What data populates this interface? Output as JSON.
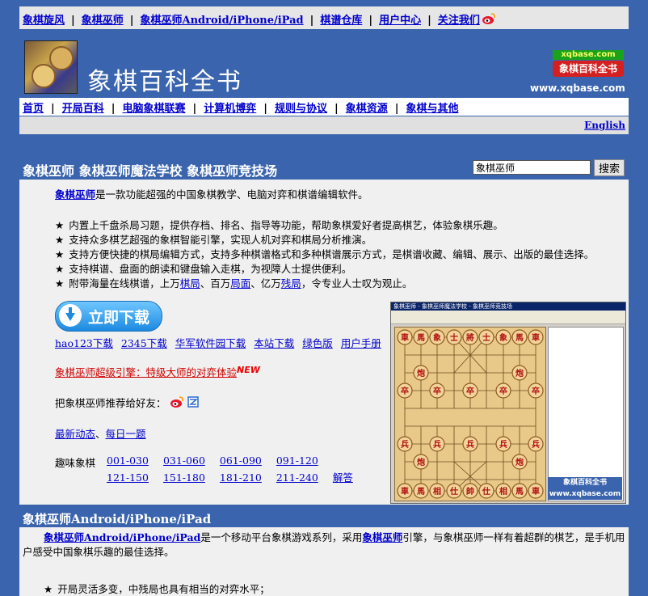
{
  "top_nav": {
    "items": [
      "象棋旋风",
      "象棋巫师",
      "象棋巫师Android/iPhone/iPad",
      "棋谱仓库",
      "用户中心",
      "关注我们"
    ],
    "separator": "|"
  },
  "banner": {
    "title": "象棋百科全书",
    "badge_top": "xqbase.com",
    "badge_bottom": "象棋百科全书",
    "url": "www.xqbase.com"
  },
  "main_nav": {
    "items": [
      "首页",
      "开局百科",
      "电脑象棋联赛",
      "计算机博弈",
      "规则与协议",
      "象棋资源",
      "象棋与其他"
    ],
    "separator": "|"
  },
  "language_link": "English",
  "section1": {
    "title": "象棋巫师  象棋巫师魔法学校  象棋巫师竞技场",
    "search": {
      "value": "象棋巫师",
      "button": "搜索"
    },
    "intro_link": "象棋巫师",
    "intro_text": "是一款功能超强的中国象棋教学、电脑对弈和棋谱编辑软件。",
    "features": [
      "内置上千盘杀局习题，提供存档、排名、指导等功能，帮助象棋爱好者提高棋艺，体验象棋乐趣。",
      "支持众多棋艺超强的象棋智能引擎，实现人机对弈和棋局分析推演。",
      "支持方便快捷的棋局编辑方式，支持多种棋谱格式和多种棋谱展示方式，是棋谱收藏、编辑、展示、出版的最佳选择。",
      "支持棋谱、盘面的朗读和键盘输入走棋，为视障人士提供便利。"
    ],
    "feature5": {
      "pre": "附带海量在线棋谱，上万",
      "link1": "棋局",
      "mid1": "、百万",
      "link2": "局面",
      "mid2": "、亿万",
      "link3": "残局",
      "post": "，令专业人士叹为观止。"
    },
    "star": "★",
    "download_button": "立即下载",
    "download_links": [
      "hao123下载",
      "2345下载",
      "华军软件园下载",
      "本站下载",
      "绿色版",
      "用户手册"
    ],
    "engine_link": "象棋巫师超级引擎：特级大师的对弈体验",
    "new_tag": "NEW",
    "recommend_text": "把象棋巫师推荐给好友：",
    "news": {
      "link1": "最新动态",
      "sep": "、",
      "link2": "每日一题"
    },
    "puzzles": {
      "label": "趣味象棋",
      "row1": [
        "001-030",
        "031-060",
        "061-090",
        "091-120"
      ],
      "row2": [
        "121-150",
        "151-180",
        "181-210",
        "211-240",
        "解答"
      ]
    },
    "screenshot": {
      "window_title": "象棋巫师 - 象棋巫师魔法学校 - 象棋巫师竞技场",
      "logo_text": "象棋百科全书",
      "logo_url": "www.xqbase.com",
      "pieces": {
        "top_row": [
          "車",
          "馬",
          "象",
          "士",
          "將",
          "士",
          "象",
          "馬",
          "車"
        ],
        "cannons_top": "炮",
        "pawns_top": "卒",
        "pawns_bottom": "兵",
        "cannons_bottom": "炮",
        "bottom_row": [
          "車",
          "馬",
          "相",
          "仕",
          "帥",
          "仕",
          "相",
          "馬",
          "車"
        ]
      }
    }
  },
  "section2": {
    "title": "象棋巫师Android/iPhone/iPad",
    "link1": "象棋巫师Android/iPhone/iPad",
    "text1": "是一个移动平台象棋游戏系列，采用",
    "link2": "象棋巫师",
    "text2": "引擎，与象棋巫师一样有着超群的棋艺，是手机用户感受中国象棋乐趣的最佳选择。",
    "feature1": "开局灵活多变，中残局也具有相当的对弈水平；"
  }
}
